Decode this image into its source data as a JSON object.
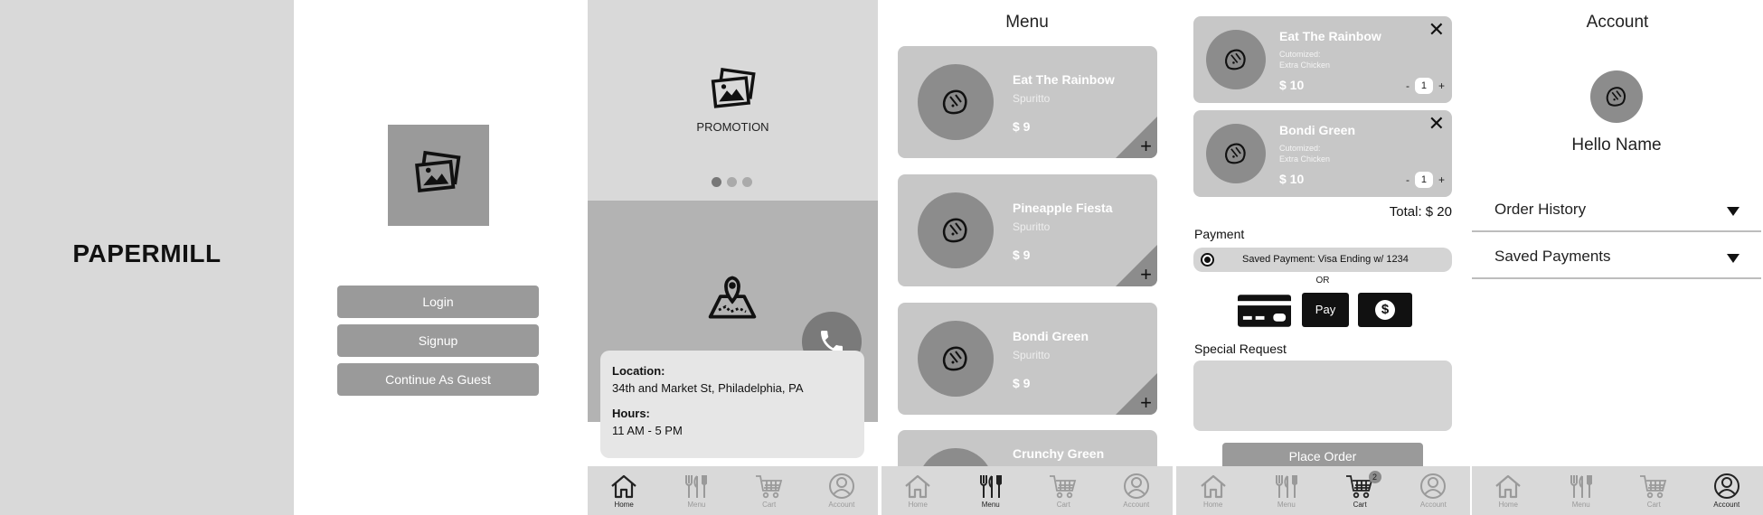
{
  "splash": {
    "brand": "PAPERMILL"
  },
  "login": {
    "buttons": [
      "Login",
      "Signup",
      "Continue As Guest"
    ]
  },
  "home": {
    "promotion_label": "PROMOTION",
    "location_heading": "Location:",
    "location_value": "34th and Market St, Philadelphia, PA",
    "hours_heading": "Hours:",
    "hours_value": "11 AM - 5 PM"
  },
  "menu": {
    "title": "Menu",
    "items": [
      {
        "name": "Eat The Rainbow",
        "sub": "Spuritto",
        "price": "$ 9"
      },
      {
        "name": "Pineapple Fiesta",
        "sub": "Spuritto",
        "price": "$ 9"
      },
      {
        "name": "Bondi Green",
        "sub": "Spuritto",
        "price": "$ 9"
      },
      {
        "name": "Crunchy Green",
        "sub": "",
        "price": ""
      }
    ]
  },
  "cart": {
    "items": [
      {
        "name": "Eat The Rainbow",
        "line1": "Cutomized:",
        "line2": "Extra Chicken",
        "price": "$ 10",
        "qty": "1"
      },
      {
        "name": "Bondi Green",
        "line1": "Cutomized:",
        "line2": "Extra Chicken",
        "price": "$ 10",
        "qty": "1"
      }
    ],
    "total": "Total: $ 20",
    "payment_label": "Payment",
    "saved_payment": "Saved Payment: Visa Ending w/ 1234",
    "or": "OR",
    "apple_pay": "Pay",
    "special_request_label": "Special Request",
    "place_order": "Place Order",
    "badge": "2"
  },
  "account": {
    "title": "Account",
    "greeting": "Hello Name",
    "rows": [
      "Order History",
      "Saved Payments"
    ]
  },
  "tabs": [
    "Home",
    "Menu",
    "Cart",
    "Account"
  ],
  "colors": {
    "panel": "#d9d9d9",
    "button": "#9a9a9a",
    "card": "#c7c7c7",
    "dark": "#8c8c8c"
  }
}
